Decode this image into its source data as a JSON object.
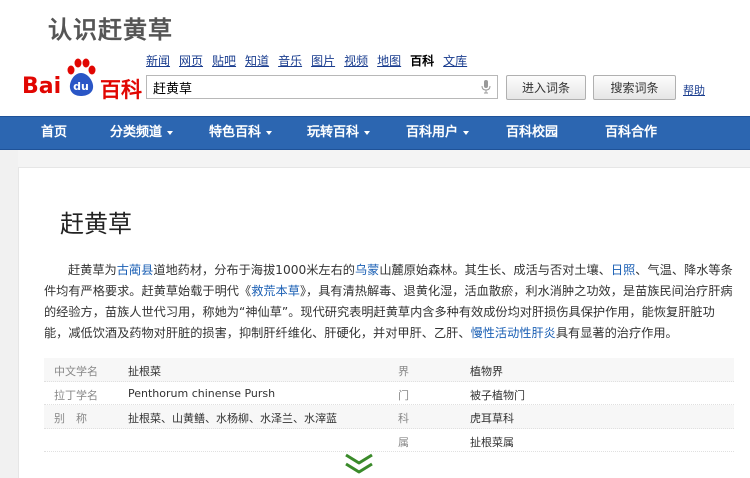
{
  "page_heading": "认识赶黄草",
  "logo": {
    "part1": "Bai",
    "part2": "du",
    "part3": "百科"
  },
  "top_nav": [
    {
      "label": "新闻",
      "active": false
    },
    {
      "label": "网页",
      "active": false
    },
    {
      "label": "贴吧",
      "active": false
    },
    {
      "label": "知道",
      "active": false
    },
    {
      "label": "音乐",
      "active": false
    },
    {
      "label": "图片",
      "active": false
    },
    {
      "label": "视频",
      "active": false
    },
    {
      "label": "地图",
      "active": false
    },
    {
      "label": "百科",
      "active": true
    },
    {
      "label": "文库",
      "active": false
    }
  ],
  "search": {
    "value": "赶黄草"
  },
  "buttons": {
    "enter": "进入词条",
    "search": "搜索词条",
    "help": "帮助"
  },
  "main_nav": [
    {
      "label": "首页",
      "dropdown": false
    },
    {
      "label": "分类频道",
      "dropdown": true
    },
    {
      "label": "特色百科",
      "dropdown": true
    },
    {
      "label": "玩转百科",
      "dropdown": true
    },
    {
      "label": "百科用户",
      "dropdown": true
    },
    {
      "label": "百科校园",
      "dropdown": false
    },
    {
      "label": "百科合作",
      "dropdown": false
    }
  ],
  "article": {
    "title": "赶黄草",
    "summary": {
      "s1": "赶黄草为",
      "l1": "古蔺县",
      "s2": "道地药材，分布于海拔1000米左右的",
      "l2": "乌蒙",
      "s3": "山麓原始森林。其生长、成活与否对土壤、",
      "l3": "日照",
      "s4": "、气温、降水等条件均有严格要求。赶黄草始载于明代《",
      "l4": "救荒本草",
      "s5": "》，具有清热解毒、退黄化湿，活血散瘀，利水消肿之功效，是苗族民间治疗肝病的经验方，苗族人世代习用，称她为“神仙草”。现代研究表明赶黄草内含多种有效成份均对肝损伤具保护作用，能恢复肝脏功能，减低饮酒及药物对肝脏的损害，抑制肝纤维化、肝硬化，并对甲肝、乙肝、",
      "l5": "慢性活动性肝炎",
      "s6": "具有显著的治疗作用。"
    }
  },
  "infobox": [
    {
      "k1": "中文学名",
      "v1": "扯根菜",
      "k2": "界",
      "v2": "植物界"
    },
    {
      "k1": "拉丁学名",
      "v1": "Penthorum chinense Pursh",
      "k2": "门",
      "v2": "被子植物门"
    },
    {
      "k1": "别　称",
      "v1": "扯根菜、山黄鳝、水杨柳、水泽兰、水滓蓝",
      "k2": "科",
      "v2": "虎耳草科"
    },
    {
      "k1": "",
      "v1": "",
      "k2": "属",
      "v2": "扯根菜属"
    }
  ],
  "colors": {
    "brand_red": "#e10602",
    "nav_blue": "#2c66b1",
    "link_blue": "#1a5fb4",
    "expand_green": "#3a8a2a"
  },
  "icons": {
    "mic": "microphone-icon",
    "expand": "double-chevron-down-icon",
    "logo_paw": "baidu-paw-icon"
  }
}
